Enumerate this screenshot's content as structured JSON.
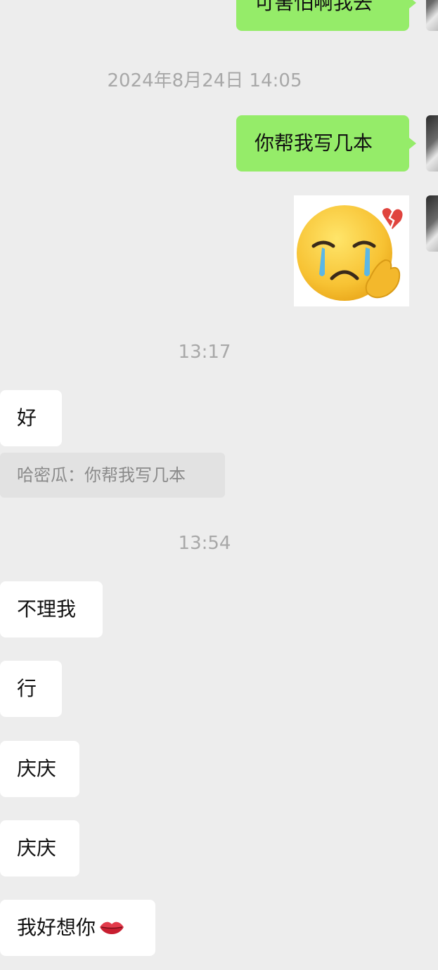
{
  "messages": {
    "m1": "可害怕啊我去",
    "ts1": "2024年8月24日 14:05",
    "m2": "你帮我写几本",
    "ts2": "13:17",
    "m3": "好",
    "quote": "哈密瓜：你帮我写几本",
    "ts3": "13:54",
    "m4": "不理我",
    "m5": "行",
    "m6": "庆庆",
    "m7": "庆庆",
    "m8": "我好想你"
  },
  "stickers": {
    "crying": "crying-face-broken-heart-sticker",
    "lips": "lips-emoji"
  },
  "colors": {
    "background": "#ededed",
    "outgoing_bubble": "#95ec69",
    "incoming_bubble": "#ffffff",
    "timestamp": "#a8a8a8",
    "quote_background": "#e2e2e2"
  }
}
